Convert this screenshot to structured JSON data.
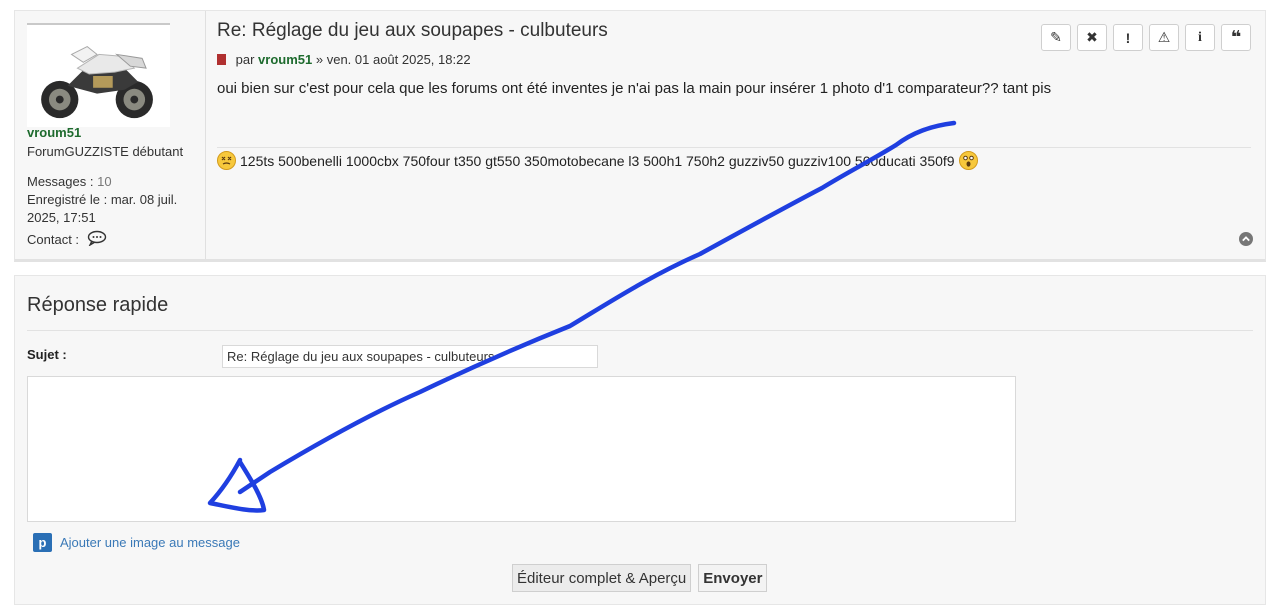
{
  "post": {
    "profile": {
      "username": "vroum51",
      "rank": "ForumGUZZISTE débutant",
      "messages_label": "Messages :",
      "messages_value": "10",
      "registered": "Enregistré le : mar. 08 juil. 2025, 17:51",
      "contact_label": "Contact :",
      "contact_icon": "speech-bubble-icon"
    },
    "title": "Re: Réglage du jeu aux soupapes - culbuteurs",
    "meta_prefix": "par",
    "author": "vroum51",
    "meta_suffix": "» ven. 01 août 2025, 18:22",
    "content": "oui bien sur c'est pour cela que les forums ont été inventes je n'ai pas la main pour insérer 1 photo d'1 comparateur?? tant pis",
    "signature": "125ts 500benelli 1000cbx 750four t350 gt550 350motobecane l3 500h1 750h2 guzziv50 guzziv100 500ducati 350f9",
    "actions": [
      {
        "name": "edit-button",
        "icon": "pencil-icon",
        "glyph": "✎"
      },
      {
        "name": "delete-button",
        "icon": "close-icon",
        "glyph": "✖"
      },
      {
        "name": "report-button",
        "icon": "exclamation-icon",
        "glyph": "!"
      },
      {
        "name": "warn-button",
        "icon": "warning-icon",
        "glyph": "⚠"
      },
      {
        "name": "info-button",
        "icon": "info-icon",
        "glyph": "i"
      },
      {
        "name": "quote-button",
        "icon": "quote-icon",
        "glyph": "❝"
      }
    ]
  },
  "quick_reply": {
    "title": "Réponse rapide",
    "subject_label": "Sujet :",
    "subject_value": "Re: Réglage du jeu aux soupapes - culbuteurs",
    "message_value": "",
    "add_image_label": "Ajouter une image au message",
    "add_image_icon_letter": "p",
    "full_editor_label": "Éditeur complet & Aperçu",
    "submit_label": "Envoyer"
  },
  "colors": {
    "username": "#1e6b2e",
    "link": "#3a79b7",
    "annotation_stroke": "#1f3fe0"
  }
}
